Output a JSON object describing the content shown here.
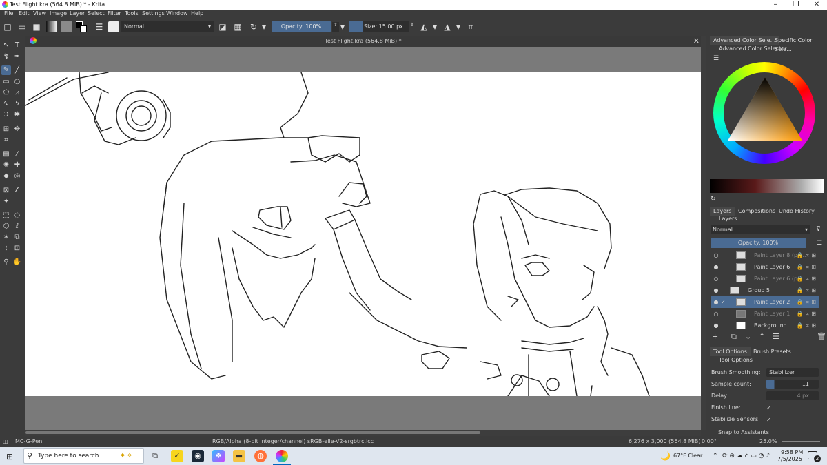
{
  "window": {
    "title": "Test Flight.kra (564.8 MiB) * - Krita",
    "minimize": "–",
    "maximize": "❐",
    "close": "✕"
  },
  "menu": [
    "File",
    "Edit",
    "View",
    "Image",
    "Layer",
    "Select",
    "Filter",
    "Tools",
    "Settings",
    "Window",
    "Help"
  ],
  "toolbar": {
    "blend_mode": "Normal",
    "opacity": "Opacity: 100%",
    "size": "Size: 15.00 px"
  },
  "canvas": {
    "document_title": "Test Flight.kra (564.8 MiB) *"
  },
  "color_selector": {
    "tabs": [
      "Advanced Color Sele...",
      "Specific Color Sele..."
    ],
    "header": "Advanced Color Selector"
  },
  "layers_panel": {
    "tabs": [
      "Layers",
      "Compositions",
      "Undo History"
    ],
    "header": "Layers",
    "blend_mode": "Normal",
    "opacity": "Opacity:  100%",
    "layers": [
      {
        "name": "Paint Layer 8 (pa...",
        "visible": false,
        "selected": false
      },
      {
        "name": "Paint Layer 6",
        "visible": true,
        "selected": false
      },
      {
        "name": "Paint Layer 6 (pa...",
        "visible": false,
        "selected": false
      },
      {
        "name": "Group 5",
        "visible": true,
        "selected": false
      },
      {
        "name": "Paint Layer 2",
        "visible": true,
        "selected": true
      },
      {
        "name": "Paint Layer 1",
        "visible": false,
        "selected": false
      },
      {
        "name": "Background",
        "visible": true,
        "selected": false
      }
    ]
  },
  "tool_options": {
    "tabs": [
      "Tool Options",
      "Brush Presets"
    ],
    "header": "Tool Options",
    "brush_smoothing_label": "Brush Smoothing:",
    "brush_smoothing_value": "Stabilizer",
    "sample_count_label": "Sample count:",
    "sample_count_value": "11",
    "delay_label": "Delay:",
    "delay_value": "4 px",
    "finish_line_label": "Finish line:",
    "stabilize_sensors_label": "Stabilize Sensors:",
    "snap_label": "Snap to Assistants"
  },
  "status": {
    "brush": "MC-G-Pen",
    "color_space": "RGB/Alpha (8-bit integer/channel)  sRGB-elle-V2-srgbtrc.icc",
    "dimensions": "6,276 x 3,000 (564.8 MiB)",
    "rotation": "0.00°",
    "zoom": "25.0%"
  },
  "taskbar": {
    "search_placeholder": "Type here to search",
    "weather": "67°F  Clear",
    "time": "9:58 PM",
    "date": "7/5/2025",
    "notifications": "2"
  },
  "colors": {
    "accent": "#4a6b93",
    "panel": "#3b3b3b"
  }
}
